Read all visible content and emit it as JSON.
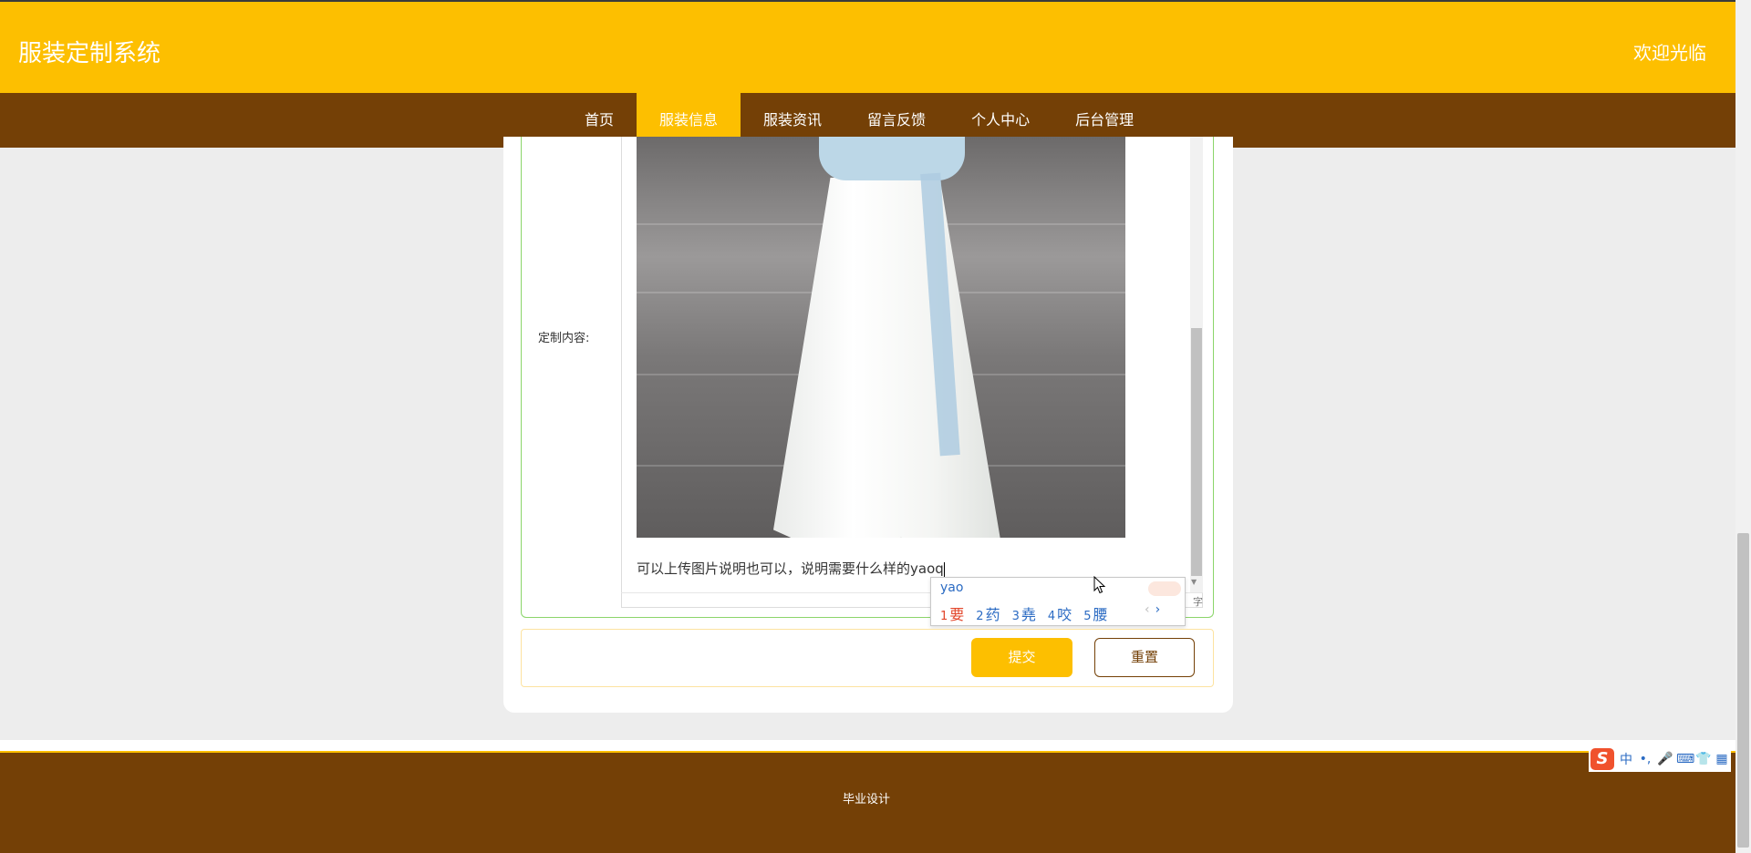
{
  "header": {
    "site_title": "服装定制系统",
    "welcome": "欢迎光临"
  },
  "nav": {
    "items": [
      {
        "label": "首页"
      },
      {
        "label": "服装信息",
        "active": true
      },
      {
        "label": "服装资讯"
      },
      {
        "label": "留言反馈"
      },
      {
        "label": "个人中心"
      },
      {
        "label": "后台管理"
      }
    ]
  },
  "form": {
    "custom_label": "定制内容:",
    "editor_text": "可以上传图片说明也可以，说明需要什么样的yaoq",
    "word_count_suffix": "字",
    "submit_label": "提交",
    "reset_label": "重置"
  },
  "ime": {
    "pinyin": "yao",
    "candidates": [
      {
        "num": "1",
        "text": "要"
      },
      {
        "num": "2",
        "text": "药"
      },
      {
        "num": "3",
        "text": "堯"
      },
      {
        "num": "4",
        "text": "咬"
      },
      {
        "num": "5",
        "text": "腰"
      }
    ],
    "prev": "‹",
    "next": "›"
  },
  "ime_toolbar": {
    "logo": "S",
    "mode": "中",
    "punct": "•,",
    "voice": "🎤",
    "keyboard": "⌨",
    "skin": "👕",
    "grid": "▦"
  },
  "footer": {
    "text": "毕业设计"
  },
  "colors": {
    "primary": "#fdbf00",
    "secondary": "#744006",
    "form_border": "#8bd56a"
  }
}
